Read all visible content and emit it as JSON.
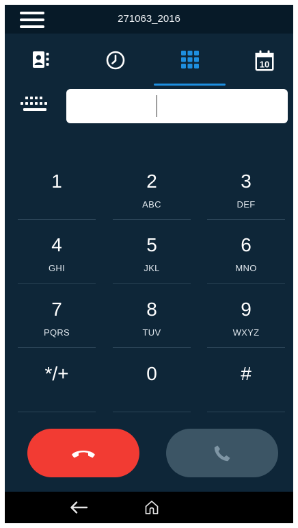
{
  "header": {
    "title": "271063_2016",
    "menu_icon": "hamburger-menu-icon"
  },
  "tabs": [
    {
      "name": "contacts",
      "icon": "contacts-icon",
      "active": false
    },
    {
      "name": "history",
      "icon": "clock-icon",
      "active": false
    },
    {
      "name": "dialpad",
      "icon": "dialpad-icon",
      "active": true
    },
    {
      "name": "calendar",
      "icon": "calendar-icon",
      "calendar_day": "10",
      "active": false
    }
  ],
  "input": {
    "keyboard_icon": "keyboard-icon",
    "value": "",
    "placeholder": ""
  },
  "keypad": [
    {
      "digit": "1",
      "letters": ""
    },
    {
      "digit": "2",
      "letters": "ABC"
    },
    {
      "digit": "3",
      "letters": "DEF"
    },
    {
      "digit": "4",
      "letters": "GHI"
    },
    {
      "digit": "5",
      "letters": "JKL"
    },
    {
      "digit": "6",
      "letters": "MNO"
    },
    {
      "digit": "7",
      "letters": "PQRS"
    },
    {
      "digit": "8",
      "letters": "TUV"
    },
    {
      "digit": "9",
      "letters": "WXYZ"
    },
    {
      "digit": "*/+",
      "letters": ""
    },
    {
      "digit": "0",
      "letters": ""
    },
    {
      "digit": "#",
      "letters": ""
    }
  ],
  "actions": {
    "hangup_icon": "hang-up-icon",
    "call_icon": "phone-icon",
    "hangup_color": "#f23b33",
    "call_color": "#3c5565"
  },
  "navbar": {
    "back_icon": "back-arrow-icon",
    "home_icon": "home-icon"
  },
  "colors": {
    "background": "#0e2638",
    "accent": "#1e8fe0"
  }
}
